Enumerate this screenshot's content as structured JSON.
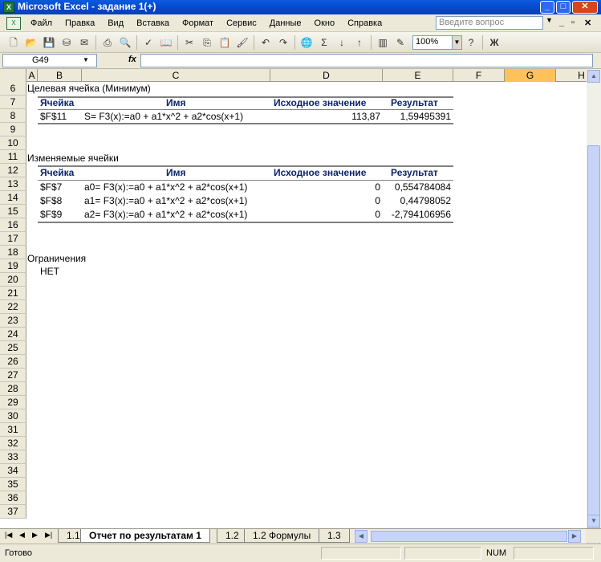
{
  "window": {
    "title": "Microsoft Excel - задание 1(+)",
    "min": "_",
    "max": "□",
    "close": "✕"
  },
  "menu": {
    "items": [
      "Файл",
      "Правка",
      "Вид",
      "Вставка",
      "Формат",
      "Сервис",
      "Данные",
      "Окно",
      "Справка"
    ],
    "ask_placeholder": "Введите вопрос"
  },
  "toolbar": {
    "zoom": "100%",
    "bold": "Ж"
  },
  "formula": {
    "cell_ref": "G49",
    "fx": "fx",
    "content": ""
  },
  "columns": [
    "A",
    "B",
    "C",
    "D",
    "E",
    "F",
    "G",
    "H"
  ],
  "selected_column": "G",
  "rows": [
    "6",
    "7",
    "8",
    "9",
    "10",
    "11",
    "12",
    "13",
    "14",
    "15",
    "16",
    "17",
    "18",
    "19",
    "20",
    "21",
    "22",
    "23",
    "24",
    "25",
    "26",
    "27",
    "28",
    "29",
    "30",
    "31",
    "32",
    "33",
    "34",
    "35",
    "36",
    "37"
  ],
  "report": {
    "target_title": "Целевая ячейка (Минимум)",
    "headers": {
      "cell": "Ячейка",
      "name": "Имя",
      "initial": "Исходное значение",
      "result": "Результат"
    },
    "target_row": {
      "cell": "$F$11",
      "name": "S= F3(x):=a0 + a1*x^2 + a2*cos(x+1)",
      "initial": "113,87",
      "result": "1,59495391"
    },
    "changing_title": "Изменяемые ячейки",
    "changing_rows": [
      {
        "cell": "$F$7",
        "name": "a0= F3(x):=a0 + a1*x^2 + a2*cos(x+1)",
        "initial": "0",
        "result": "0,554784084"
      },
      {
        "cell": "$F$8",
        "name": "a1= F3(x):=a0 + a1*x^2 + a2*cos(x+1)",
        "initial": "0",
        "result": "0,44798052"
      },
      {
        "cell": "$F$9",
        "name": "a2= F3(x):=a0 + a1*x^2 + a2*cos(x+1)",
        "initial": "0",
        "result": "-2,794106956"
      }
    ],
    "constraints_title": "Ограничения",
    "constraints_value": "НЕТ"
  },
  "sheets": [
    "1.1",
    "Отчет по результатам 1",
    "1.2",
    "1.2 Формулы",
    "1.3"
  ],
  "active_sheet": "Отчет по результатам 1",
  "status": {
    "ready": "Готово",
    "num": "NUM"
  }
}
